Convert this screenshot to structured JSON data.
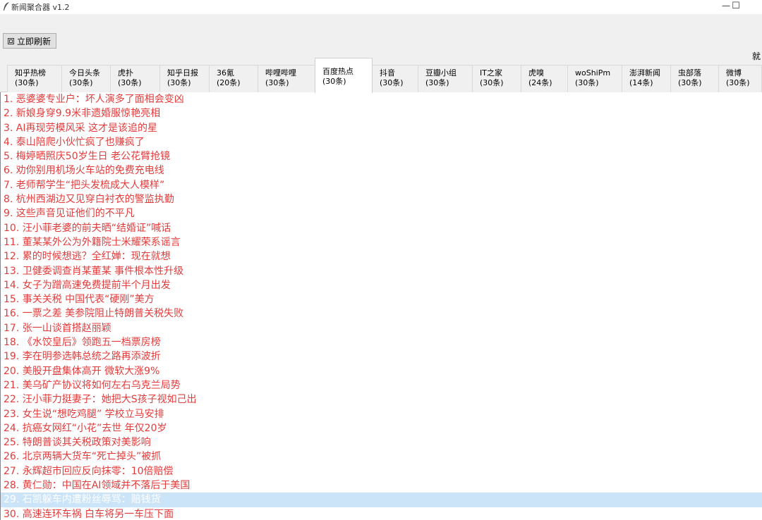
{
  "window": {
    "title": "新闻聚合器 v1.2",
    "minimize_glyph": "—",
    "maximize_glyph": "☐",
    "icon": "feather-icon"
  },
  "toolbar": {
    "refresh_label": "立即刷新",
    "refresh_icon": "refresh-icon",
    "status": "就"
  },
  "tabs": [
    {
      "name": "知乎热榜",
      "count": "(30条)"
    },
    {
      "name": "今日头条",
      "count": "(30条)"
    },
    {
      "name": "虎扑",
      "count": "(30条)"
    },
    {
      "name": "知乎日报",
      "count": "(30条)"
    },
    {
      "name": "36氪",
      "count": "(20条)"
    },
    {
      "name": "哔哩哔哩",
      "count": "(30条)"
    },
    {
      "name": "百度热点",
      "count": "(30条)"
    },
    {
      "name": "抖音",
      "count": "(30条)"
    },
    {
      "name": "豆瓣小组",
      "count": "(30条)"
    },
    {
      "name": "IT之家",
      "count": "(30条)"
    },
    {
      "name": "虎嗅",
      "count": "(24条)"
    },
    {
      "name": "woShiPm",
      "count": "(30条)"
    },
    {
      "name": "澎湃新闻",
      "count": "(14条)"
    },
    {
      "name": "虫部落",
      "count": "(30条)"
    },
    {
      "name": "微博",
      "count": "(30条)"
    }
  ],
  "active_tab": 6,
  "selected_row": 28,
  "colors": {
    "headline": "#e23b3b",
    "selection": "#cce4f7"
  },
  "headlines": [
    "1. 恶婆婆专业户：坏人演多了面相会变凶",
    "2. 新娘身穿9.9米非遗婚服惊艳亮相",
    "3. AI再现劳模风采 这才是该追的星",
    "4. 泰山陪爬小伙忙疯了也赚疯了",
    "5. 梅婷晒照庆50岁生日 老公花臂抢镜",
    "6. 劝你别用机场火车站的免费充电线",
    "7. 老师帮学生“把头发梳成大人模样”",
    "8. 杭州西湖边又见穿白衬衣的警监执勤",
    "9. 这些声音见证他们的不平凡",
    "10. 汪小菲老婆的前夫晒“结婚证”喊话",
    "11. 董某某外公为外籍院士米耀荣系谣言",
    "12. 累的时候想逃？全红婵：现在就想",
    "13. 卫健委调查肖某董某 事件根本性升级",
    "14. 女子为蹭高速免费提前半个月出发",
    "15. 事关关税 中国代表“硬刚”美方",
    "16. 一票之差 美参院阻止特朗普关税失败",
    "17. 张一山谈首搭赵丽颖",
    "18. 《水饺皇后》领跑五一档票房榜",
    "19. 李在明参选韩总统之路再添波折",
    "20. 美股开盘集体高开 微软大涨9%",
    "21. 美乌矿产协议将如何左右乌克兰局势",
    "22. 汪小菲力挺妻子：她把大S孩子视如己出",
    "23. 女生说“想吃鸡腿” 学校立马安排",
    "24. 抗癌女网红“小花”去世 年仅20岁",
    "25. 特朗普谈其关税政策对美影响",
    "26. 北京两辆大货车“死亡掉头”被抓",
    "27. 永辉超市回应反向抹零：10倍赔偿",
    "28. 黄仁勋：中国在AI领域并不落后于美国",
    "29. 石凯躲车内遭粉丝辱骂：赔钱货",
    "30. 高速连环车祸 白车将另一车压下面"
  ]
}
